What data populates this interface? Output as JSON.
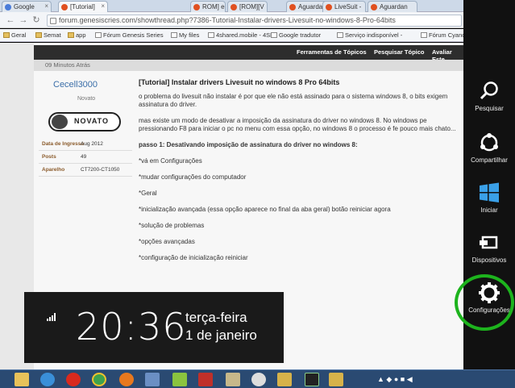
{
  "browser": {
    "tabs": [
      {
        "label": "Google",
        "color": "#4a7cd9"
      },
      {
        "label": "[Tutorial]",
        "color": "#e05020"
      },
      {
        "label": "ROM] e P",
        "color": "#e05020"
      },
      {
        "label": "Aguardan",
        "color": "#e05020"
      },
      {
        "label": "[ROM][V",
        "color": "#e05020"
      },
      {
        "label": "LiveSuit -",
        "color": "#e05020"
      },
      {
        "label": "Aguardan",
        "color": "#e05020"
      }
    ],
    "url": "forum.genesiscries.com/showthread.php?7386-Tutorial-Instalar-drivers-Livesuit-no-windows-8-Pro-64bits",
    "bookmarks": [
      "Geral",
      "Semat",
      "app",
      "Fórum Genesis Series",
      "My files",
      "4shared.mobile - 4SH",
      "Google tradutor",
      "Serviço indisponível -",
      "Fórum Cyanogen"
    ]
  },
  "forum": {
    "nav": [
      "Ferramentas de Tópicos",
      "Pesquisar Tópico",
      "Avaliar Este"
    ],
    "post_time": "09 Minutos Atrás",
    "username": "Cecell3000",
    "user_title": "Novato",
    "rank_badge": "NOVATO",
    "user_info": [
      {
        "key": "Data de Ingresso",
        "value": "Aug 2012"
      },
      {
        "key": "Posts",
        "value": "49"
      },
      {
        "key": "Aparelho",
        "value": "CT7200-CT1050"
      }
    ],
    "post_title": "[Tutorial] Instalar drivers Livesuit no windows 8 Pro 64bits",
    "post_paragraphs": [
      "o problema do livesuit não instalar é por que ele não está assinado para o sistema windows 8, o bits exigem assinatura do driver.",
      "mas existe um modo de desativar a imposição da assinatura do driver no windows 8. No windows pe pressionando F8 para iniciar o pc no menu com essa opção, no windows 8 o processo é fe pouco mais chato...",
      "passo 1: Desativando imposição de assinatura do driver no windows 8:",
      "*vá em Configurações",
      "*mudar configurações do computador",
      "*Geral",
      "*inicialização avançada (essa opção aparece no final da aba geral) botão reiniciar agora",
      "*solução de problemas",
      "*opções avançadas",
      "*configuração de inicialização reiniciar"
    ]
  },
  "clock": {
    "time": "20:36",
    "weekday": "terça-feira",
    "date": "1 de janeiro"
  },
  "charms": [
    {
      "label": "Pesquisar",
      "icon": "search-icon"
    },
    {
      "label": "Compartilhar",
      "icon": "share-icon"
    },
    {
      "label": "Iniciar",
      "icon": "windows-icon"
    },
    {
      "label": "Dispositivos",
      "icon": "devices-icon"
    },
    {
      "label": "Configurações",
      "icon": "gear-icon"
    }
  ],
  "highlight_color": "#1db31d"
}
